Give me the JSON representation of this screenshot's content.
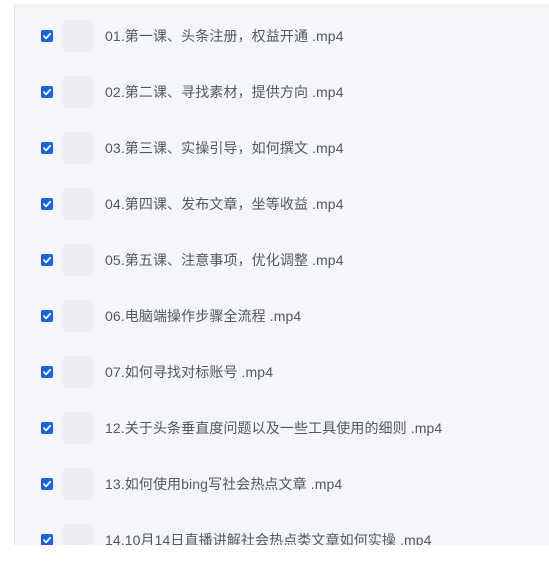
{
  "file_list": {
    "items": [
      {
        "name": "01.第一课、头条注册，权益开通 .mp4",
        "checked": true
      },
      {
        "name": "02.第二课、寻找素材，提供方向 .mp4",
        "checked": true
      },
      {
        "name": "03.第三课、实操引导，如何撰文 .mp4",
        "checked": true
      },
      {
        "name": "04.第四课、发布文章，坐等收益 .mp4",
        "checked": true
      },
      {
        "name": "05.第五课、注意事项，优化调整 .mp4",
        "checked": true
      },
      {
        "name": "06.电脑端操作步骤全流程 .mp4",
        "checked": true
      },
      {
        "name": "07.如何寻找对标账号 .mp4",
        "checked": true
      },
      {
        "name": "12.关于头条垂直度问题以及一些工具使用的细则 .mp4",
        "checked": true
      },
      {
        "name": "13.如何使用bing写社会热点文章 .mp4",
        "checked": true
      },
      {
        "name": "14.10月14日直播讲解社会热点类文章如何实操 .mp4",
        "checked": true
      }
    ]
  },
  "icons": {
    "checkbox": "checkbox-checked-icon",
    "thumbnail": "video-thumbnail"
  },
  "colors": {
    "checkbox": "#1a5fe6",
    "text": "#545861",
    "panel_bg": "#f5f6fa",
    "thumb_bg": "#eceef2"
  }
}
